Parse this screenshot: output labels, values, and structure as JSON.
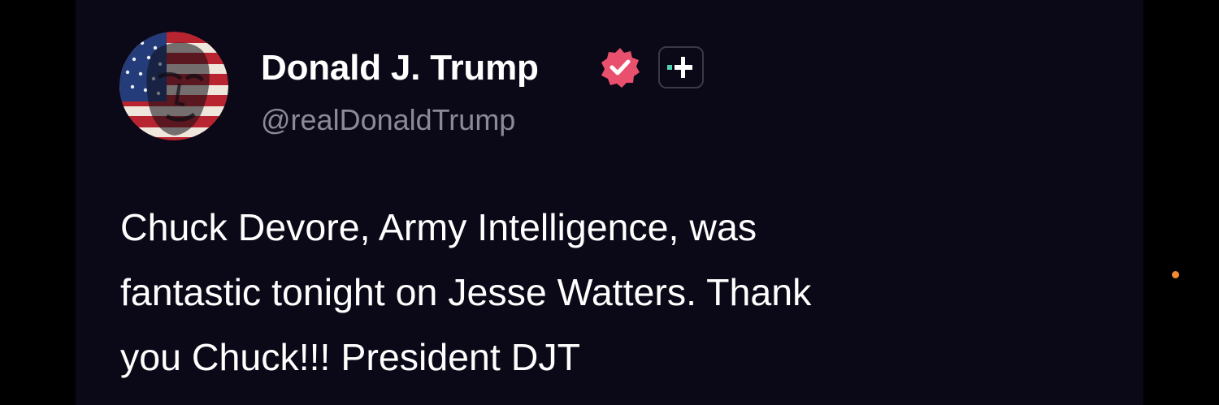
{
  "post": {
    "author_name": "Donald J. Trump",
    "handle": "@realDonaldTrump",
    "verified_icon": "verified-badge-icon",
    "add_icon": "plus-icon",
    "body_lines": [
      "Chuck Devore, Army Intelligence, was",
      "fantastic tonight on Jesse Watters. Thank",
      "you Chuck!!! President DJT"
    ]
  },
  "colors": {
    "background": "#000000",
    "card": "#0b0917",
    "text": "#ffffff",
    "handle": "#8c8a99",
    "badge": "#e8506d",
    "indicator": "#f28b2f"
  }
}
